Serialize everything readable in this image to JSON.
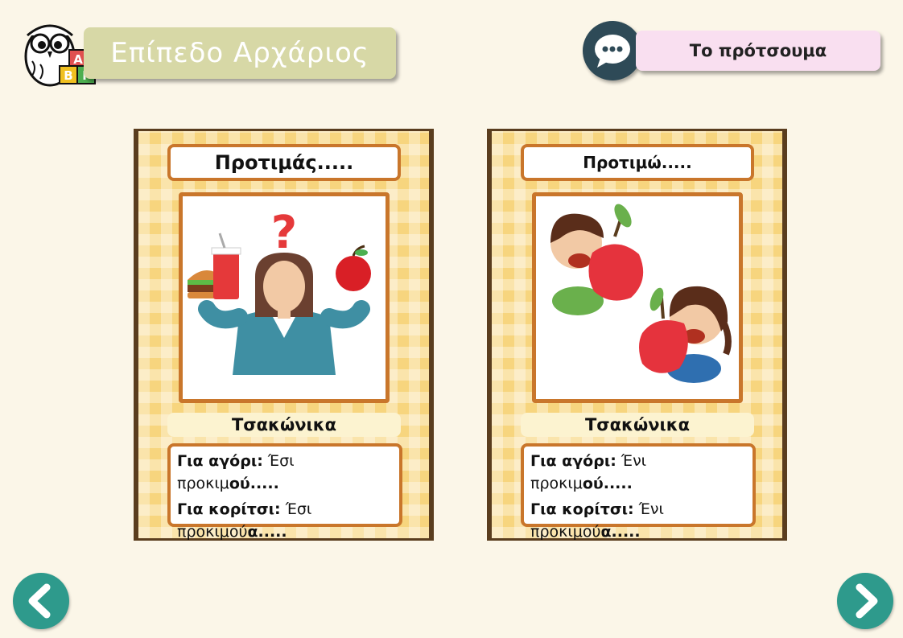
{
  "header": {
    "level_title": "Επίπεδο Αρχάριος",
    "sample_button_label": "Το πρότσουμα",
    "logo_blocks": [
      "Α",
      "Β",
      "Γ"
    ]
  },
  "cards": [
    {
      "title": "Προτιμάς.....",
      "dialect": "Τσακώνικα",
      "boy_label": "Για αγόρι:",
      "boy_text": "Έσι προκιμ",
      "boy_ending": "ού.....",
      "girl_label": "Για κορίτσι:",
      "girl_text": "Έσι προκιμού",
      "girl_ending": "α....."
    },
    {
      "title": "Προτιμώ.....",
      "dialect": "Τσακώνικα",
      "boy_label": "Για αγόρι:",
      "boy_text": "Ένι προκιμ",
      "boy_ending": "ού.....",
      "girl_label": "Για κορίτσι:",
      "girl_text": "Ένι προκιμού",
      "girl_ending": "α....."
    }
  ],
  "nav": {
    "prev_icon": "chevron-left-icon",
    "next_icon": "chevron-right-icon"
  },
  "colors": {
    "background": "#fbf6e8",
    "card": "#f7d57e",
    "border": "#c9762b",
    "nav": "#2e9a8c",
    "chat": "#2e4a57"
  }
}
